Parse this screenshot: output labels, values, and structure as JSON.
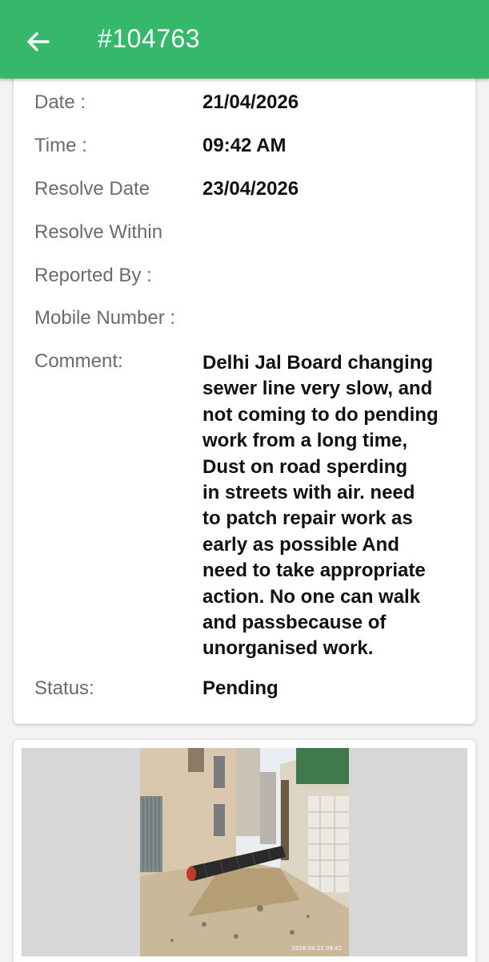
{
  "header": {
    "title": "#104763",
    "accent_color": "#36b86b",
    "back_icon": "arrow-left-icon"
  },
  "details": {
    "date_label": "Date :",
    "date_value": "21/04/2026",
    "time_label": "Time :",
    "time_value": "09:42 AM",
    "resolve_date_label": "Resolve Date",
    "resolve_date_value": "23/04/2026",
    "resolve_within_label": "Resolve Within",
    "reported_by_label": "Reported By :",
    "mobile_label": "Mobile Number :",
    "comment_label": "Comment:",
    "comment_lines": [
      "Delhi Jal Board changing",
      "sewer line very slow, and",
      "not coming to do pending",
      "work from a long time,",
      "Dust on road sperding",
      "in streets with air. need",
      "to patch repair work as",
      "early as possible And",
      "need to take appropriate",
      "action. No one can walk",
      "and passbecause of",
      "unorganised work."
    ],
    "status_label": "Status:",
    "status_value": "Pending"
  },
  "photo": {
    "timestamp": "2026.04.21 09:42"
  }
}
